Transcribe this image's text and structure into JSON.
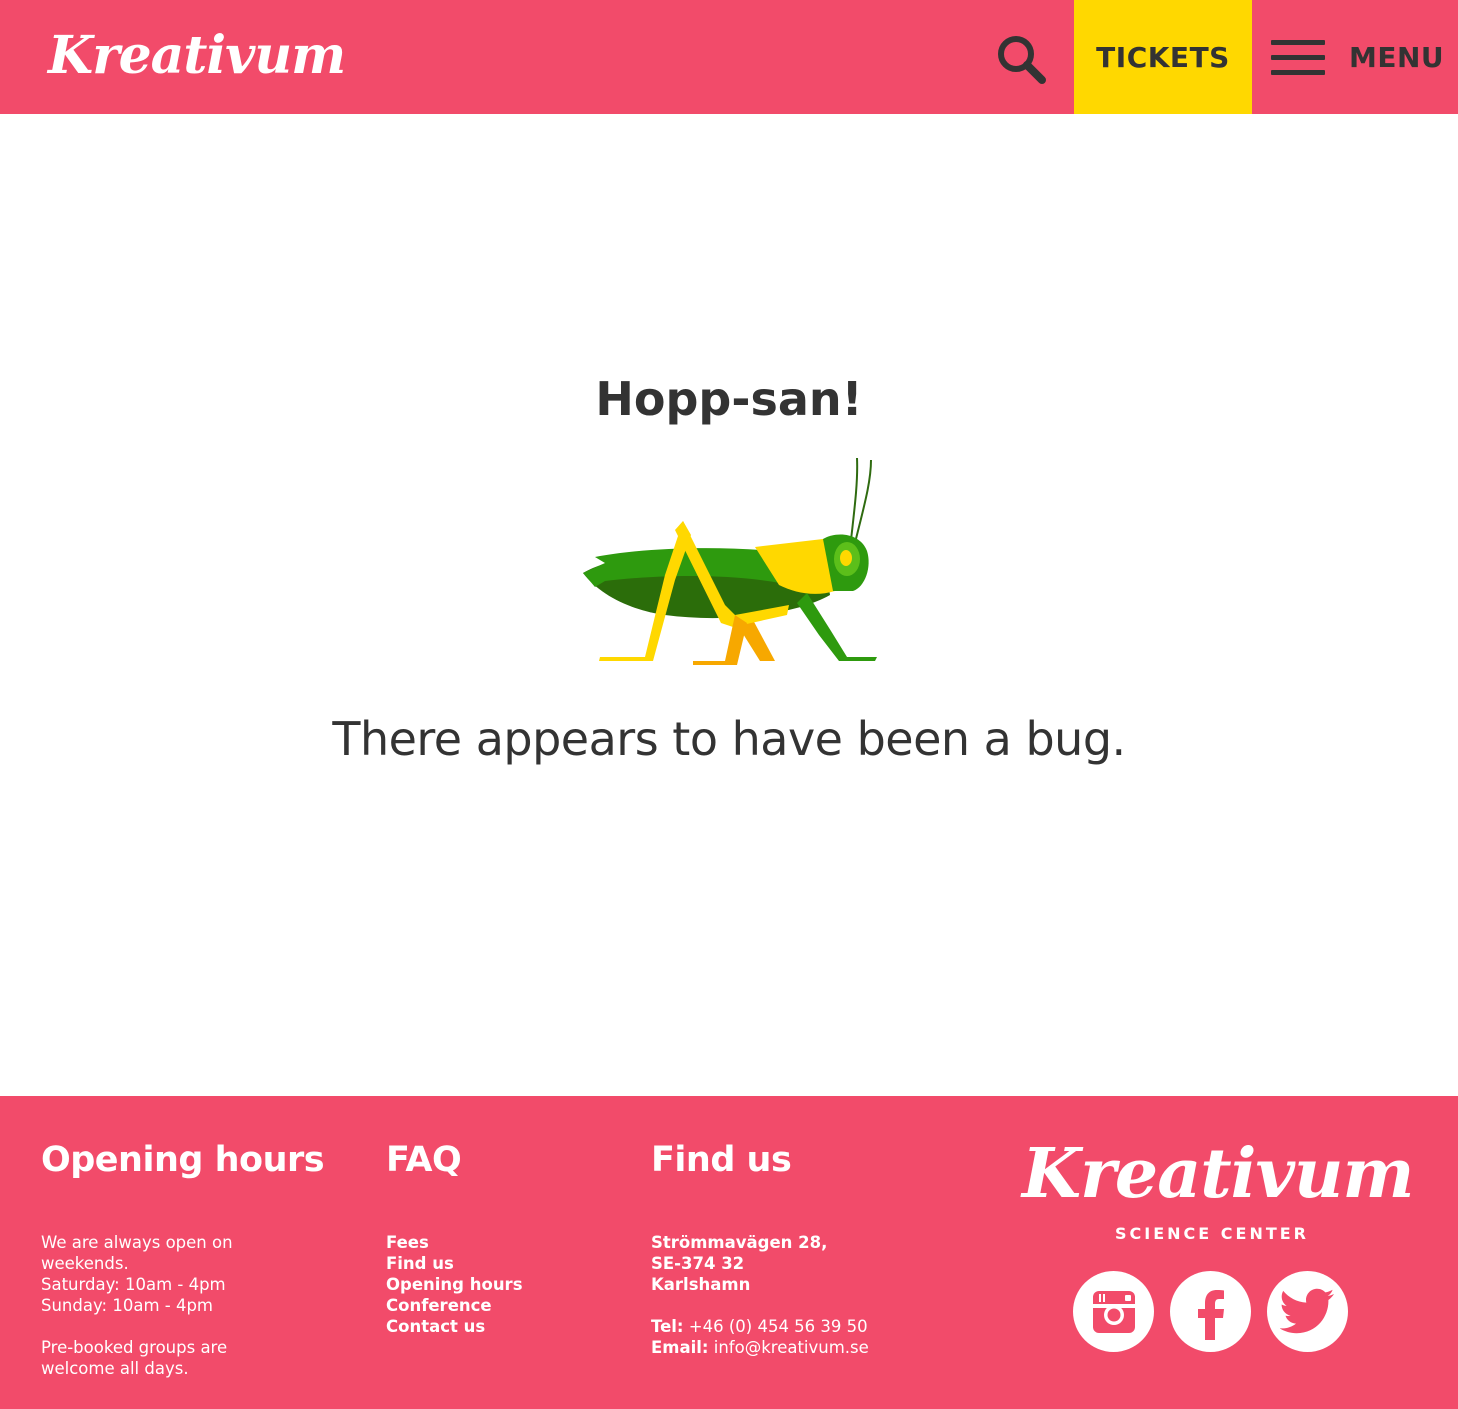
{
  "header": {
    "logo_text": "Kreativum",
    "tickets_label": "TICKETS",
    "menu_label": "MENU",
    "icons": {
      "search": "search-icon",
      "menu": "hamburger-icon"
    },
    "colors": {
      "brand": "#f24b6a",
      "tickets_bg": "#ffd800",
      "text_dark": "#333333"
    }
  },
  "main": {
    "title": "Hopp-san!",
    "illustration": "grasshopper-illustration",
    "message": "There appears to have been a bug."
  },
  "footer": {
    "opening_hours": {
      "heading": "Opening hours",
      "lines": [
        "We are always open on",
        "weekends.",
        "Saturday: 10am - 4pm",
        "Sunday: 10am - 4pm"
      ],
      "note_lines": [
        "Pre-booked groups are",
        "welcome all days."
      ]
    },
    "faq": {
      "heading": "FAQ",
      "links": [
        "Fees",
        "Find us",
        "Opening hours",
        "Conference",
        "Contact us"
      ]
    },
    "find_us": {
      "heading": "Find us",
      "address_lines": [
        "Strömmavägen 28,",
        "SE-374 32",
        "Karlshamn"
      ],
      "tel_label": "Tel:",
      "tel_value": "+46 (0) 454 56 39 50",
      "email_label": "Email:",
      "email_value": "info@kreativum.se"
    },
    "logo_text": "Kreativum",
    "logo_subtitle": "SCIENCE CENTER",
    "social": [
      {
        "name": "instagram",
        "icon": "instagram-icon"
      },
      {
        "name": "facebook",
        "icon": "facebook-icon"
      },
      {
        "name": "twitter",
        "icon": "twitter-icon"
      }
    ]
  }
}
